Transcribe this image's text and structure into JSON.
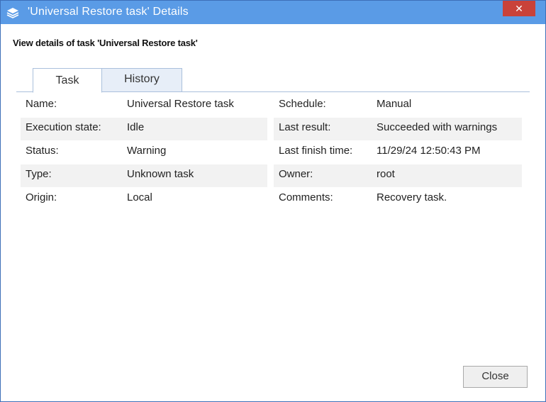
{
  "window": {
    "title": "'Universal Restore task' Details",
    "close_glyph": "✕",
    "app_icon": "layers-icon"
  },
  "subtitle": "View details of task 'Universal Restore task'",
  "tabs": [
    {
      "label": "Task",
      "active": true
    },
    {
      "label": "History",
      "active": false
    }
  ],
  "details": {
    "rows": [
      {
        "left_label": "Name:",
        "left_value": "Universal Restore task",
        "right_label": "Schedule:",
        "right_value": "Manual"
      },
      {
        "left_label": "Execution state:",
        "left_value": "Idle",
        "right_label": "Last result:",
        "right_value": "Succeeded with warnings"
      },
      {
        "left_label": "Status:",
        "left_value": "Warning",
        "right_label": "Last finish time:",
        "right_value": "11/29/24 12:50:43 PM"
      },
      {
        "left_label": "Type:",
        "left_value": "Unknown task",
        "right_label": "Owner:",
        "right_value": "root"
      },
      {
        "left_label": "Origin:",
        "left_value": "Local",
        "right_label": "Comments:",
        "right_value": "Recovery task."
      }
    ]
  },
  "buttons": {
    "close_label": "Close"
  },
  "colors": {
    "titlebar": "#5a9be6",
    "close_button": "#c9423a",
    "row_shade": "#f2f2f2"
  }
}
